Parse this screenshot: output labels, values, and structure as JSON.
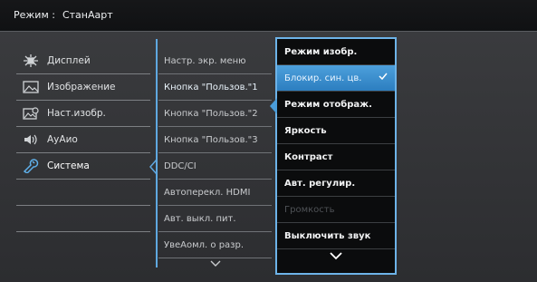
{
  "header": {
    "mode_label": "Режим :",
    "mode_value": "СтанАарт"
  },
  "left_menu": [
    {
      "label": "Дисплей",
      "icon": "display-settings-icon"
    },
    {
      "label": "Изображение",
      "icon": "picture-icon"
    },
    {
      "label": "Наст.изобр.",
      "icon": "picture-settings-icon"
    },
    {
      "label": "АуАио",
      "icon": "speaker-icon"
    },
    {
      "label": "Система",
      "icon": "wrench-icon",
      "active": true
    }
  ],
  "middle_menu": [
    {
      "label": "Настр. экр. меню"
    },
    {
      "label": "Кнопка \"Пользов.\"1",
      "selected": true
    },
    {
      "label": "Кнопка \"Пользов.\"2"
    },
    {
      "label": "Кнопка \"Пользов.\"3"
    },
    {
      "label": "DDC/CI"
    },
    {
      "label": "Автоперекл. HDMI"
    },
    {
      "label": "Авт. выкл. пит."
    },
    {
      "label": "УвеАомл. о разр."
    }
  ],
  "right_menu": [
    {
      "label": "Режим изобр."
    },
    {
      "label": "Блокир. син. цв.",
      "highlight": true,
      "checked": true
    },
    {
      "label": "Режим отображ."
    },
    {
      "label": "Яркость"
    },
    {
      "label": "Контраст"
    },
    {
      "label": "Авт. регулир."
    },
    {
      "label": "Громкость",
      "disabled": true
    },
    {
      "label": "Выключить звук"
    }
  ],
  "colors": {
    "accent": "#4a9dda",
    "highlight_top": "#4da0dc",
    "panel_bg": "#0b0c0d"
  }
}
